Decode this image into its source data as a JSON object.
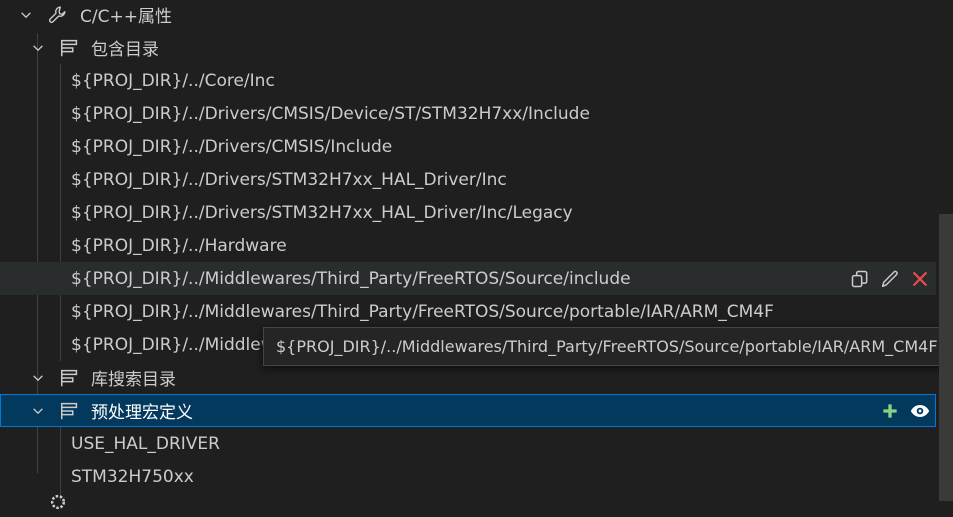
{
  "tree": {
    "root": {
      "label": "C/C++属性",
      "icon": "wrench-icon"
    },
    "include_section": {
      "label": "包含目录",
      "items": [
        "${PROJ_DIR}/../Core/Inc",
        "${PROJ_DIR}/../Drivers/CMSIS/Device/ST/STM32H7xx/Include",
        "${PROJ_DIR}/../Drivers/CMSIS/Include",
        "${PROJ_DIR}/../Drivers/STM32H7xx_HAL_Driver/Inc",
        "${PROJ_DIR}/../Drivers/STM32H7xx_HAL_Driver/Inc/Legacy",
        "${PROJ_DIR}/../Hardware",
        "${PROJ_DIR}/../Middlewares/Third_Party/FreeRTOS/Source/include",
        "${PROJ_DIR}/../Middlewares/Third_Party/FreeRTOS/Source/portable/IAR/ARM_CM4F",
        "${PROJ_DIR}/../Middlewares/Third_Party/FreeRTOS/Source/portable/IAR/ARM_CM4F"
      ]
    },
    "lib_section": {
      "label": "库搜索目录"
    },
    "macro_section": {
      "label": "预处理宏定义",
      "items": [
        "USE_HAL_DRIVER",
        "STM32H750xx"
      ]
    }
  },
  "tooltip": {
    "text": "${PROJ_DIR}/../Middlewares/Third_Party/FreeRTOS/Source/portable/IAR/ARM_CM4F"
  },
  "colors": {
    "accent": "#0078d4",
    "selected_bg": "#04395e",
    "delete": "#f14c4c",
    "add": "#89d185"
  }
}
